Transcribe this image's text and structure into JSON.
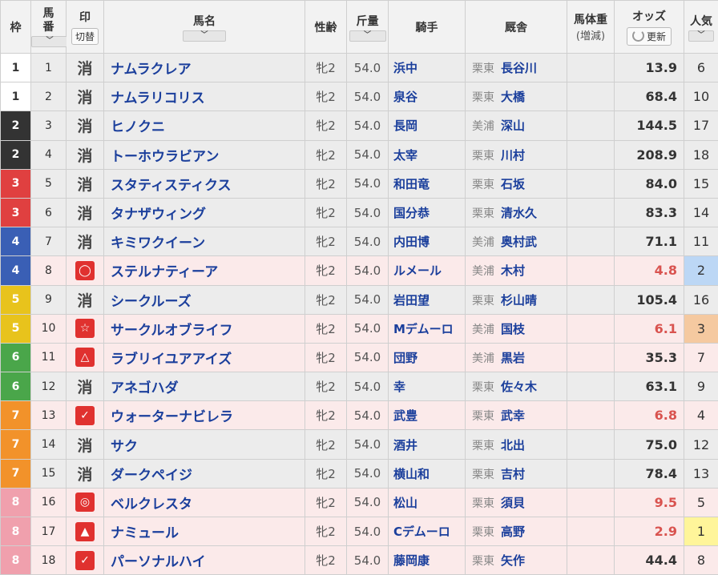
{
  "header": {
    "waku": "枠",
    "umaban": "馬\n番",
    "mark": "印",
    "toggle": "切替",
    "name": "馬名",
    "sexage": "性齢",
    "kinryo": "斤量",
    "jockey": "騎手",
    "stable": "厩舎",
    "weight": "馬体重",
    "weight_sub": "(増減)",
    "odds": "オッズ",
    "refresh": "更新",
    "ninki": "人気",
    "sort_glyph": "﹀"
  },
  "colors": {
    "waku": {
      "1": "#ffffff",
      "2": "#333333",
      "3": "#e04040",
      "4": "#3a5fb5",
      "5": "#e8c31c",
      "6": "#4aa64a",
      "7": "#f2922a",
      "8": "#f0a0ad"
    },
    "waku_text": {
      "1": "#333333",
      "2": "#ffffff",
      "3": "#ffffff",
      "4": "#ffffff",
      "5": "#ffffff",
      "6": "#ffffff",
      "7": "#ffffff",
      "8": "#ffffff"
    },
    "ninki_1": "#fff59a",
    "ninki_2": "#bcd7f5",
    "ninki_3": "#f5c9a0"
  },
  "rows": [
    {
      "waku": "1",
      "num": "1",
      "mark": "消",
      "name": "ナムラクレア",
      "sexage": "牝2",
      "kinryo": "54.0",
      "jockey": "浜中",
      "area": "栗東",
      "trainer": "長谷川",
      "odds": "13.9",
      "ninki": "6",
      "bg": "gray"
    },
    {
      "waku": "1",
      "num": "2",
      "mark": "消",
      "name": "ナムラリコリス",
      "sexage": "牝2",
      "kinryo": "54.0",
      "jockey": "泉谷",
      "area": "栗東",
      "trainer": "大橋",
      "odds": "68.4",
      "ninki": "10",
      "bg": "gray"
    },
    {
      "waku": "2",
      "num": "3",
      "mark": "消",
      "name": "ヒノクニ",
      "sexage": "牝2",
      "kinryo": "54.0",
      "jockey": "長岡",
      "area": "美浦",
      "trainer": "深山",
      "odds": "144.5",
      "ninki": "17",
      "bg": "gray"
    },
    {
      "waku": "2",
      "num": "4",
      "mark": "消",
      "name": "トーホウラビアン",
      "sexage": "牝2",
      "kinryo": "54.0",
      "jockey": "太宰",
      "area": "栗東",
      "trainer": "川村",
      "odds": "208.9",
      "ninki": "18",
      "bg": "gray"
    },
    {
      "waku": "3",
      "num": "5",
      "mark": "消",
      "name": "スタティスティクス",
      "sexage": "牝2",
      "kinryo": "54.0",
      "jockey": "和田竜",
      "area": "栗東",
      "trainer": "石坂",
      "odds": "84.0",
      "ninki": "15",
      "bg": "gray"
    },
    {
      "waku": "3",
      "num": "6",
      "mark": "消",
      "name": "タナザウィング",
      "sexage": "牝2",
      "kinryo": "54.0",
      "jockey": "国分恭",
      "area": "栗東",
      "trainer": "清水久",
      "odds": "83.3",
      "ninki": "14",
      "bg": "gray"
    },
    {
      "waku": "4",
      "num": "7",
      "mark": "消",
      "name": "キミワクイーン",
      "sexage": "牝2",
      "kinryo": "54.0",
      "jockey": "内田博",
      "area": "美浦",
      "trainer": "奥村武",
      "odds": "71.1",
      "ninki": "11",
      "bg": "gray"
    },
    {
      "waku": "4",
      "num": "8",
      "mark": "◯",
      "name": "ステルナティーア",
      "sexage": "牝2",
      "kinryo": "54.0",
      "jockey": "ルメール",
      "area": "美浦",
      "trainer": "木村",
      "odds": "4.8",
      "ninki": "2",
      "bg": "pink",
      "low": true
    },
    {
      "waku": "5",
      "num": "9",
      "mark": "消",
      "name": "シークルーズ",
      "sexage": "牝2",
      "kinryo": "54.0",
      "jockey": "岩田望",
      "area": "栗東",
      "trainer": "杉山晴",
      "odds": "105.4",
      "ninki": "16",
      "bg": "gray"
    },
    {
      "waku": "5",
      "num": "10",
      "mark": "☆",
      "name": "サークルオブライフ",
      "sexage": "牝2",
      "kinryo": "54.0",
      "jockey": "Mデムーロ",
      "area": "美浦",
      "trainer": "国枝",
      "odds": "6.1",
      "ninki": "3",
      "bg": "pink",
      "low": true
    },
    {
      "waku": "6",
      "num": "11",
      "mark": "△",
      "name": "ラブリイユアアイズ",
      "sexage": "牝2",
      "kinryo": "54.0",
      "jockey": "団野",
      "area": "美浦",
      "trainer": "黒岩",
      "odds": "35.3",
      "ninki": "7",
      "bg": "pink"
    },
    {
      "waku": "6",
      "num": "12",
      "mark": "消",
      "name": "アネゴハダ",
      "sexage": "牝2",
      "kinryo": "54.0",
      "jockey": "幸",
      "area": "栗東",
      "trainer": "佐々木",
      "odds": "63.1",
      "ninki": "9",
      "bg": "gray"
    },
    {
      "waku": "7",
      "num": "13",
      "mark": "✓",
      "name": "ウォーターナビレラ",
      "sexage": "牝2",
      "kinryo": "54.0",
      "jockey": "武豊",
      "area": "栗東",
      "trainer": "武幸",
      "odds": "6.8",
      "ninki": "4",
      "bg": "pink",
      "low": true
    },
    {
      "waku": "7",
      "num": "14",
      "mark": "消",
      "name": "サク",
      "sexage": "牝2",
      "kinryo": "54.0",
      "jockey": "酒井",
      "area": "栗東",
      "trainer": "北出",
      "odds": "75.0",
      "ninki": "12",
      "bg": "gray"
    },
    {
      "waku": "7",
      "num": "15",
      "mark": "消",
      "name": "ダークペイジ",
      "sexage": "牝2",
      "kinryo": "54.0",
      "jockey": "横山和",
      "area": "栗東",
      "trainer": "吉村",
      "odds": "78.4",
      "ninki": "13",
      "bg": "gray"
    },
    {
      "waku": "8",
      "num": "16",
      "mark": "◎",
      "name": "ベルクレスタ",
      "sexage": "牝2",
      "kinryo": "54.0",
      "jockey": "松山",
      "area": "栗東",
      "trainer": "須貝",
      "odds": "9.5",
      "ninki": "5",
      "bg": "pink",
      "low": true
    },
    {
      "waku": "8",
      "num": "17",
      "mark": "▲",
      "name": "ナミュール",
      "sexage": "牝2",
      "kinryo": "54.0",
      "jockey": "Cデムーロ",
      "area": "栗東",
      "trainer": "高野",
      "odds": "2.9",
      "ninki": "1",
      "bg": "pink",
      "low": true
    },
    {
      "waku": "8",
      "num": "18",
      "mark": "✓",
      "name": "パーソナルハイ",
      "sexage": "牝2",
      "kinryo": "54.0",
      "jockey": "藤岡康",
      "area": "栗東",
      "trainer": "矢作",
      "odds": "44.4",
      "ninki": "8",
      "bg": "pink"
    }
  ]
}
